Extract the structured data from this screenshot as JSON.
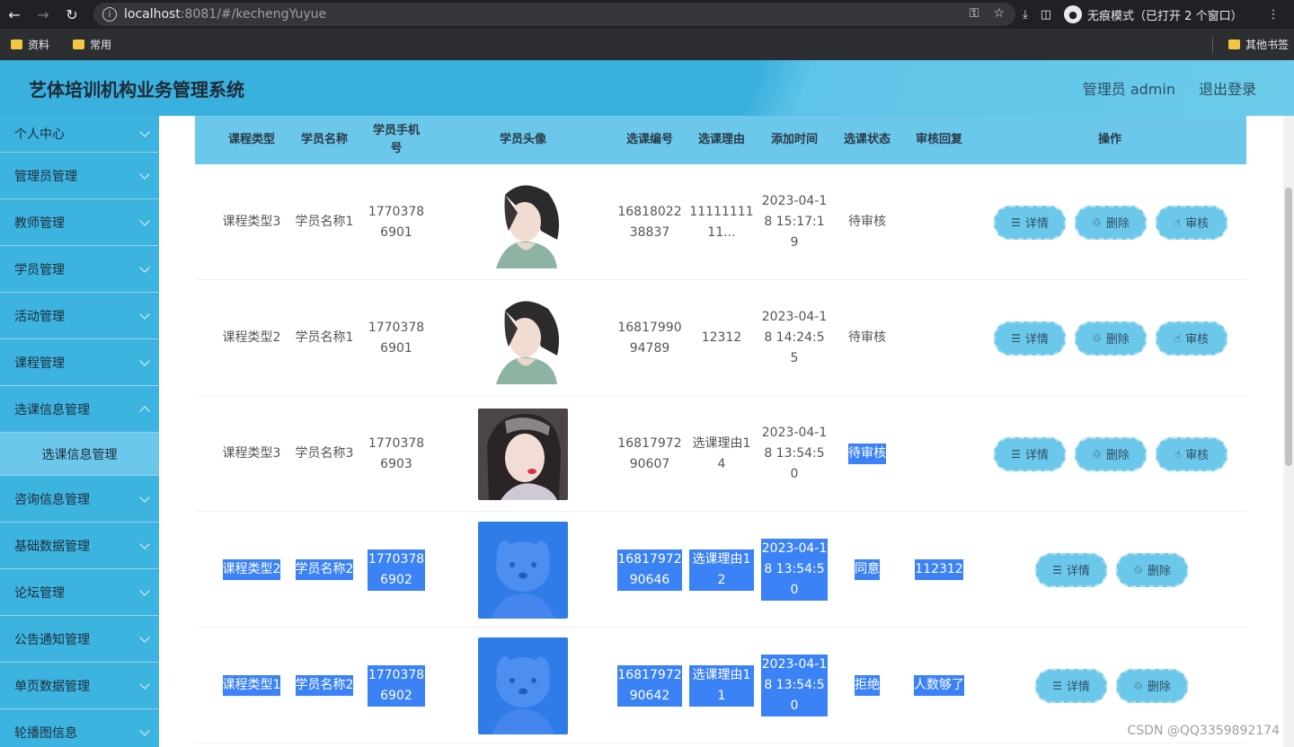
{
  "browser": {
    "url_host": "localhost",
    "url_rest": ":8081/#/kechengYuyue",
    "incognito_label": "无痕模式（已打开 2 个窗口）",
    "bookmarks": [
      "资料",
      "常用"
    ],
    "other_bookmarks": "其他书签"
  },
  "header": {
    "title": "艺体培训机构业务管理系统",
    "user_label": "管理员 admin",
    "logout_label": "退出登录"
  },
  "sidebar": {
    "items": [
      "个人中心",
      "管理员管理",
      "教师管理",
      "学员管理",
      "活动管理",
      "课程管理",
      "选课信息管理"
    ],
    "active_sub": "选课信息管理",
    "items_after": [
      "咨询信息管理",
      "基础数据管理",
      "论坛管理",
      "公告通知管理",
      "单页数据管理",
      "轮播图信息"
    ]
  },
  "table": {
    "headers": {
      "type": "课程类型",
      "name": "学员名称",
      "phone": "学员手机号",
      "avatar": "学员头像",
      "code": "选课编号",
      "reason": "选课理由",
      "time": "添加时间",
      "status": "选课状态",
      "reply": "审核回复",
      "ops": "操作"
    },
    "rows": [
      {
        "type": "课程类型3",
        "name": "学员名称1",
        "phone": "17703786901",
        "code": "1681802238837",
        "reason": "1111111111...",
        "time": "2023-04-18 15:17:19",
        "status": "待审核",
        "reply": "",
        "avatar": "girl-drawing",
        "selected": false,
        "status_selected": false
      },
      {
        "type": "课程类型2",
        "name": "学员名称1",
        "phone": "17703786901",
        "code": "1681799094789",
        "reason": "12312",
        "time": "2023-04-18 14:24:55",
        "status": "待审核",
        "reply": "",
        "avatar": "girl-drawing",
        "selected": false,
        "status_selected": false
      },
      {
        "type": "课程类型3",
        "name": "学员名称3",
        "phone": "17703786903",
        "code": "1681797290607",
        "reason": "选课理由14",
        "time": "2023-04-18 13:54:50",
        "status": "待审核",
        "reply": "",
        "avatar": "girl-photo",
        "selected": false,
        "status_selected": true
      },
      {
        "type": "课程类型2",
        "name": "学员名称2",
        "phone": "17703786902",
        "code": "1681797290646",
        "reason": "选课理由12",
        "time": "2023-04-18 13:54:50",
        "status": "同意",
        "reply": "112312",
        "avatar": "dog-photo",
        "selected": true,
        "status_selected": true
      },
      {
        "type": "课程类型1",
        "name": "学员名称2",
        "phone": "17703786902",
        "code": "1681797290642",
        "reason": "选课理由11",
        "time": "2023-04-18 13:54:50",
        "status": "拒绝",
        "reply": "人数够了",
        "avatar": "dog-photo",
        "selected": true,
        "status_selected": true
      }
    ],
    "btn_detail": "详情",
    "btn_delete": "删除",
    "btn_review": "审核"
  },
  "watermark": "CSDN @QQ3359892174",
  "colors": {
    "accent": "#3db3e0",
    "header": "#6cc8ea",
    "selection": "#3b82f6"
  }
}
